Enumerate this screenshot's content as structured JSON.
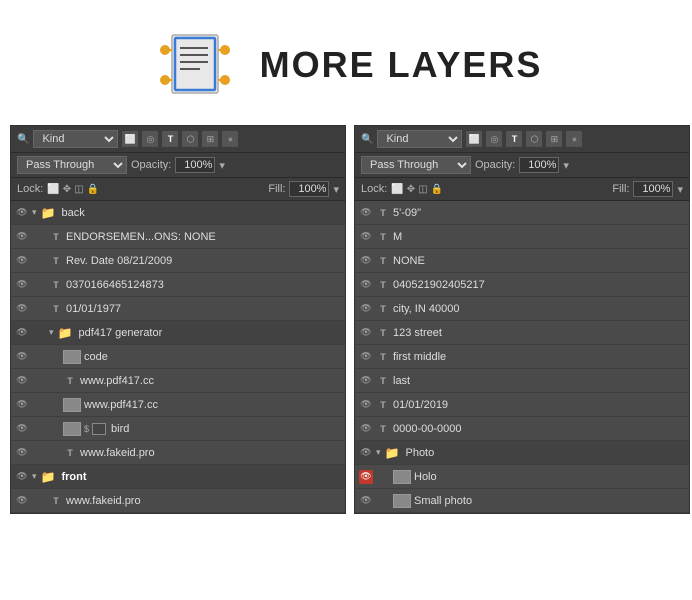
{
  "header": {
    "title": "MORE LAYERS"
  },
  "left_panel": {
    "kind_label": "Kind",
    "pass_through_label": "Pass Through",
    "opacity_label": "Opacity:",
    "opacity_value": "100%",
    "fill_label": "Fill:",
    "fill_value": "100%",
    "lock_label": "Lock:",
    "layers": [
      {
        "id": "back-group",
        "indent": 0,
        "type": "group",
        "name": "back",
        "eye": true,
        "thumb": "folder",
        "selected": false
      },
      {
        "id": "endorsements",
        "indent": 1,
        "type": "T",
        "name": "ENDORSEMEN...ONS: NONE",
        "eye": true,
        "thumb": null,
        "selected": false
      },
      {
        "id": "rev-date",
        "indent": 1,
        "type": "T",
        "name": "Rev. Date 08/21/2009",
        "eye": true,
        "thumb": null,
        "selected": false
      },
      {
        "id": "barcode",
        "indent": 1,
        "type": "T",
        "name": "0370166465124873",
        "eye": true,
        "thumb": null,
        "selected": false
      },
      {
        "id": "dob",
        "indent": 1,
        "type": "T",
        "name": "01/01/1977",
        "eye": true,
        "thumb": null,
        "selected": false
      },
      {
        "id": "pdf417-group",
        "indent": 1,
        "type": "group",
        "name": "pdf417 generator",
        "eye": true,
        "thumb": "folder",
        "selected": false
      },
      {
        "id": "code",
        "indent": 2,
        "type": "img",
        "name": "code",
        "eye": true,
        "thumb": "img",
        "selected": false
      },
      {
        "id": "www-pdf417-1",
        "indent": 2,
        "type": "T",
        "name": "www.pdf417.cc",
        "eye": true,
        "thumb": null,
        "selected": false
      },
      {
        "id": "www-pdf417-2",
        "indent": 2,
        "type": "img",
        "name": "www.pdf417.cc",
        "eye": true,
        "thumb": "img",
        "selected": false
      },
      {
        "id": "bird",
        "indent": 2,
        "type": "img",
        "name": "bird",
        "eye": true,
        "thumb": "img",
        "dollar": true,
        "selected": false
      },
      {
        "id": "fakeid",
        "indent": 2,
        "type": "T",
        "name": "www.fakeid.pro",
        "eye": true,
        "thumb": null,
        "selected": false
      },
      {
        "id": "front-group",
        "indent": 0,
        "type": "group",
        "name": "front",
        "eye": true,
        "thumb": "folder",
        "selected": true
      },
      {
        "id": "fakeid2",
        "indent": 1,
        "type": "T",
        "name": "www.fakeid.pro",
        "eye": true,
        "thumb": null,
        "selected": false
      }
    ]
  },
  "right_panel": {
    "kind_label": "Kind",
    "pass_through_label": "Pass Through",
    "opacity_label": "Opacity:",
    "opacity_value": "100%",
    "fill_label": "Fill:",
    "fill_value": "100%",
    "lock_label": "Lock:",
    "layers": [
      {
        "id": "r-height",
        "indent": 0,
        "type": "T",
        "name": "5'-09\"",
        "eye": true,
        "selected": false
      },
      {
        "id": "r-m",
        "indent": 0,
        "type": "T",
        "name": "M",
        "eye": true,
        "selected": false
      },
      {
        "id": "r-none",
        "indent": 0,
        "type": "T",
        "name": "NONE",
        "eye": true,
        "selected": false
      },
      {
        "id": "r-barcode2",
        "indent": 0,
        "type": "T",
        "name": "040521902405217",
        "eye": true,
        "selected": false
      },
      {
        "id": "r-city",
        "indent": 0,
        "type": "T",
        "name": "city, IN 40000",
        "eye": true,
        "selected": false
      },
      {
        "id": "r-street",
        "indent": 0,
        "type": "T",
        "name": "123 street",
        "eye": true,
        "selected": false
      },
      {
        "id": "r-firstmid",
        "indent": 0,
        "type": "T",
        "name": "first middle",
        "eye": true,
        "selected": false
      },
      {
        "id": "r-last",
        "indent": 0,
        "type": "T",
        "name": "last",
        "eye": true,
        "selected": false
      },
      {
        "id": "r-dob2",
        "indent": 0,
        "type": "T",
        "name": "01/01/2019",
        "eye": true,
        "selected": false
      },
      {
        "id": "r-dd",
        "indent": 0,
        "type": "T",
        "name": "0000-00-0000",
        "eye": true,
        "selected": false
      },
      {
        "id": "r-photo-group",
        "indent": 0,
        "type": "group",
        "name": "Photo",
        "eye": true,
        "thumb": "folder",
        "selected": false
      },
      {
        "id": "r-holo",
        "indent": 1,
        "type": "img",
        "name": "Holo",
        "eye": "red",
        "thumb": "img",
        "selected": false
      },
      {
        "id": "r-smallphoto",
        "indent": 1,
        "type": "img",
        "name": "Small photo",
        "eye": true,
        "thumb": "img",
        "selected": false
      }
    ]
  },
  "icons": {
    "eye": "👁",
    "folder": "📁",
    "search": "🔍",
    "lock": "🔒",
    "pen": "✏",
    "move": "✥",
    "chain": "⛓"
  }
}
